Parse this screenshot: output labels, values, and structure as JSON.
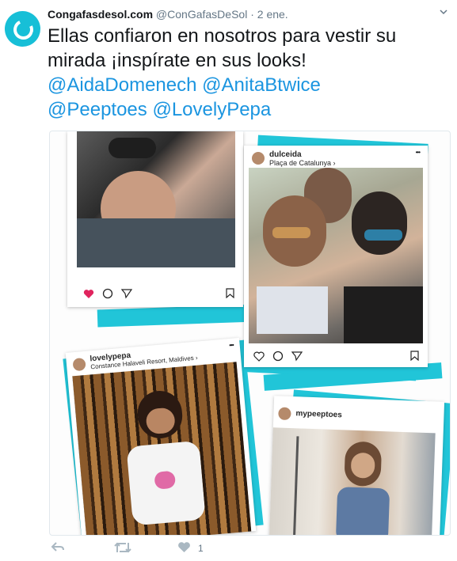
{
  "tweet": {
    "display_name": "Congafasdesol.com",
    "handle": "@ConGafasDeSol",
    "dot": "·",
    "time": "2 ene.",
    "text_line1": "Ellas confiaron en nosotros para vestir su",
    "text_line2": "mirada ¡inspírate en sus looks!",
    "mentions": [
      "@AidaDomenech",
      "@AnitaBtwice",
      "@Peeptoes",
      "@LovelyPepa"
    ],
    "like_count": "1"
  },
  "cards": {
    "dulceida": {
      "username": "dulceida",
      "location": "Plaça de Catalunya ›"
    },
    "lovelypepa": {
      "username": "lovelypepa",
      "location": "Constance Halaveli Resort, Maldives ›"
    },
    "mypeeptoes": {
      "username": "mypeeptoes"
    },
    "more": "•••"
  },
  "colors": {
    "accent": "#1b95e0",
    "brand": "#17bfd7",
    "teal": "#21c5d8",
    "heart": "#e0245e"
  },
  "icons": [
    "logo-icon",
    "chevron-down-icon",
    "heart-icon",
    "comment-icon",
    "share-icon",
    "bookmark-icon",
    "reply-icon",
    "retweet-icon",
    "like-icon"
  ]
}
